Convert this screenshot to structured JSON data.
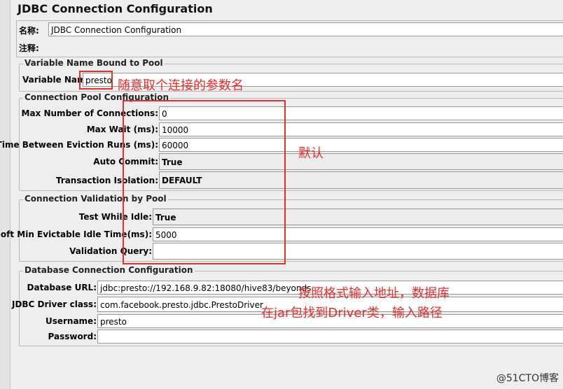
{
  "title": "JDBC Connection Configuration",
  "name_row": {
    "label": "名称:",
    "value": "JDBC Connection Configuration"
  },
  "comment_row": {
    "label": "注释:",
    "value": ""
  },
  "variable_group": {
    "title": "Variable Name Bound to Pool",
    "label": "Variable Name:",
    "value": "presto"
  },
  "pool_group": {
    "title": "Connection Pool Configuration",
    "fields": [
      {
        "label": "Max Number of Connections:",
        "value": "0"
      },
      {
        "label": "Max Wait (ms):",
        "value": "10000"
      },
      {
        "label": "Time Between Eviction Runs (ms):",
        "value": "60000"
      },
      {
        "label": "Auto Commit:",
        "value": "True"
      },
      {
        "label": "Transaction Isolation:",
        "value": "DEFAULT"
      }
    ]
  },
  "validation_group": {
    "title": "Connection Validation by Pool",
    "fields": [
      {
        "label": "Test While Idle:",
        "value": "True"
      },
      {
        "label": "Soft Min Evictable Idle Time(ms):",
        "value": "5000"
      },
      {
        "label": "Validation Query:",
        "value": ""
      }
    ]
  },
  "db_group": {
    "title": "Database Connection Configuration",
    "fields": [
      {
        "label": "Database URL:",
        "value": "jdbc:presto://192.168.9.82:18080/hive83/beyonds"
      },
      {
        "label": "JDBC Driver class:",
        "value": "com.facebook.presto.jdbc.PrestoDriver"
      },
      {
        "label": "Username:",
        "value": "presto"
      },
      {
        "label": "Password:",
        "value": ""
      }
    ]
  },
  "annotations": {
    "variable_note": "随意取个连接的参数名",
    "default_note": "默认",
    "url_note": "按照格式输入地址，数据库",
    "driver_note": "在jar包找到Driver类，输入路径"
  },
  "watermark": "@51CTO博客",
  "colors": {
    "annotation": "#e03030",
    "background": "#eeeeee"
  }
}
